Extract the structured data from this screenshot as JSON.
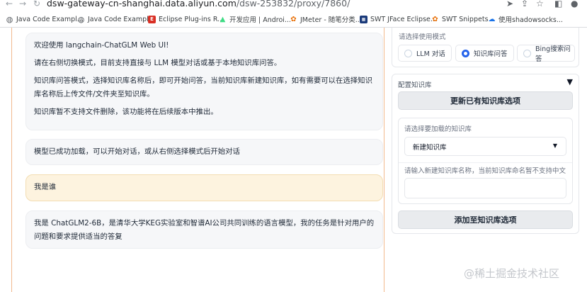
{
  "browser": {
    "url_host": "dsw-gateway-cn-shanghai.data.aliyun.com",
    "url_path": "/dsw-253832/proxy/7860/",
    "bookmarks": [
      {
        "label": "Java Code Exampl...",
        "icon": "globe-icon"
      },
      {
        "label": "Java Code Exampl...",
        "icon": "globe-icon"
      },
      {
        "label": "Eclipse Plug-ins R...",
        "icon": "eclipse-icon"
      },
      {
        "label": "开发应用 | Androi...",
        "icon": "android-icon"
      },
      {
        "label": "JMeter - 随笔分类...",
        "icon": "leaf-icon"
      },
      {
        "label": "SWT JFace Eclipse...",
        "icon": "doc-icon"
      },
      {
        "label": "SWT Snippets",
        "icon": "swt-icon"
      },
      {
        "label": "使用shadowsocks...",
        "icon": "cloud-icon"
      }
    ]
  },
  "chat": {
    "messages": [
      {
        "role": "bot",
        "paragraphs": [
          "欢迎使用 langchain-ChatGLM Web UI!",
          "请在右侧切换模式，目前支持直接与 LLM 模型对话或基于本地知识库问答。",
          "知识库问答模式，选择知识库名称后，即可开始问答，当前知识库新建知识库，如有需要可以在选择知识库名称后上传文件/文件夹至知识库。",
          "知识库暂不支持文件删除，该功能将在后续版本中推出。"
        ]
      },
      {
        "role": "bot",
        "paragraphs": [
          "模型已成功加载，可以开始对话，或从右侧选择模式后开始对话"
        ]
      },
      {
        "role": "user",
        "paragraphs": [
          "我是谁"
        ]
      },
      {
        "role": "bot",
        "paragraphs": [
          "我是 ChatGLM2-6B，是清华大学KEG实验室和智谱AI公司共同训练的语言模型，我的任务是针对用户的问题和要求提供适当的答复"
        ]
      }
    ]
  },
  "mode": {
    "label": "请选择使用模式",
    "options": [
      "LLM 对话",
      "知识库问答",
      "Bing搜索问答"
    ],
    "selected": "知识库问答"
  },
  "kb": {
    "header": "配置知识库",
    "update_button": "更新已有知识库选项",
    "select_label": "请选择要加载的知识库",
    "select_value": "新建知识库",
    "name_label": "请输入新建知识库名称，当前知识库命名暂不支持中文",
    "name_value": "",
    "add_button": "添加至知识库选项"
  },
  "watermark": "@稀土掘金技术社区",
  "colors": {
    "accent_orange": "#f2b98d",
    "radio_selected": "#2563eb",
    "user_bubble": "#fdf3df",
    "bot_bubble": "#f6f7f9"
  }
}
